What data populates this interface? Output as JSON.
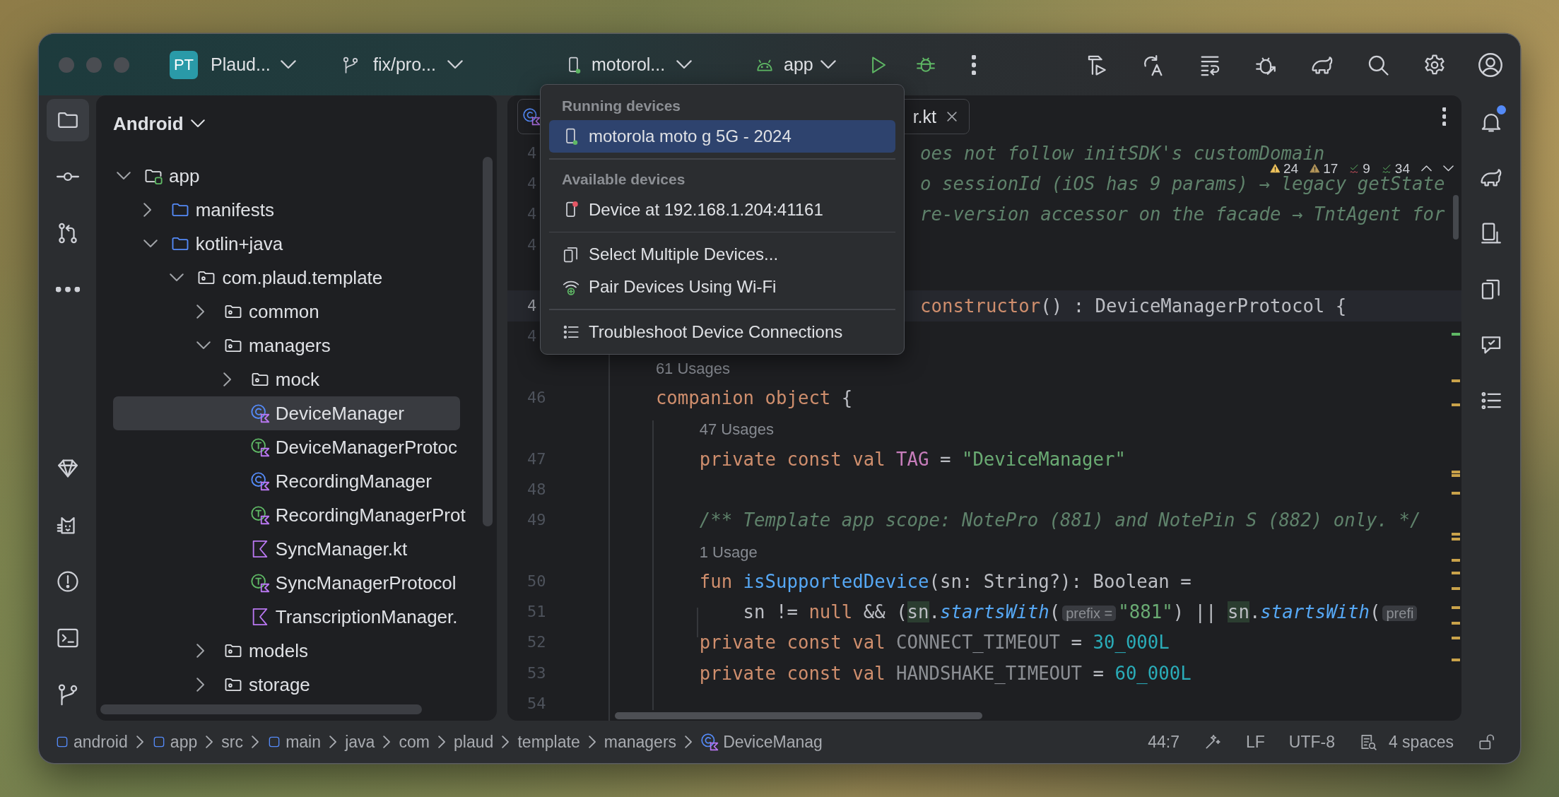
{
  "title_bar": {
    "project_badge": "PT",
    "project": "Plaud...",
    "branch": "fix/pro...",
    "device": "motorol...",
    "device_running": true,
    "run_config": "app"
  },
  "left_toolbar": {
    "top": [
      {
        "kind": "project",
        "selected": true
      },
      {
        "kind": "commit",
        "selected": false
      },
      {
        "kind": "pull_requests",
        "selected": false
      },
      {
        "kind": "more",
        "selected": false
      }
    ],
    "bottom": [
      {
        "kind": "gem",
        "selected": false
      },
      {
        "kind": "cat",
        "selected": false
      },
      {
        "kind": "problems",
        "selected": false
      },
      {
        "kind": "terminal",
        "selected": false
      },
      {
        "kind": "version_control",
        "selected": false
      }
    ]
  },
  "project_panel": {
    "view": "Android",
    "tree": [
      {
        "label": "app",
        "kind": "module",
        "expanded": true,
        "selected": false,
        "children": [
          {
            "label": "manifests",
            "kind": "folder",
            "expanded": false,
            "selected": false
          },
          {
            "label": "kotlin+java",
            "kind": "folder",
            "expanded": true,
            "selected": false,
            "children": [
              {
                "label": "com.plaud.template",
                "kind": "package",
                "expanded": true,
                "selected": false,
                "children": [
                  {
                    "label": "common",
                    "kind": "package",
                    "expanded": false,
                    "selected": false
                  },
                  {
                    "label": "managers",
                    "kind": "package",
                    "expanded": true,
                    "selected": false,
                    "children": [
                      {
                        "label": "mock",
                        "kind": "package",
                        "expanded": false,
                        "selected": false
                      },
                      {
                        "label": "DeviceManager",
                        "kind": "class",
                        "selected": true
                      },
                      {
                        "label": "DeviceManagerProtoc",
                        "kind": "interface",
                        "selected": false
                      },
                      {
                        "label": "RecordingManager",
                        "kind": "class",
                        "selected": false
                      },
                      {
                        "label": "RecordingManagerProt",
                        "kind": "interface",
                        "selected": false
                      },
                      {
                        "label": "SyncManager.kt",
                        "kind": "kotlin_file",
                        "selected": false
                      },
                      {
                        "label": "SyncManagerProtocol",
                        "kind": "interface",
                        "selected": false
                      },
                      {
                        "label": "TranscriptionManager.",
                        "kind": "kotlin_file",
                        "selected": false
                      }
                    ]
                  },
                  {
                    "label": "models",
                    "kind": "package",
                    "expanded": false,
                    "selected": false
                  },
                  {
                    "label": "storage",
                    "kind": "package",
                    "expanded": false,
                    "selected": false
                  }
                ]
              }
            ]
          }
        ]
      }
    ]
  },
  "editor": {
    "tab": {
      "label": "r.kt",
      "selected": true
    },
    "inspections": [
      {
        "kind": "warning",
        "count": "24"
      },
      {
        "kind": "weak_warning",
        "count": "17"
      },
      {
        "kind": "typo",
        "count": "9"
      },
      {
        "kind": "grammar",
        "count": "34"
      }
    ],
    "rows": [
      {
        "kind": "clipped",
        "number": "4",
        "current": false,
        "segments": [
          {
            "kind": "doc",
            "text": "oes not follow initSDK's customDomain"
          }
        ]
      },
      {
        "kind": "clipped",
        "number": "4",
        "current": false,
        "segments": [
          {
            "kind": "doc",
            "text": "o sessionId (iOS has 9 params) → legacy getState"
          }
        ]
      },
      {
        "kind": "clipped",
        "number": "4",
        "current": false,
        "segments": [
          {
            "kind": "doc",
            "text": "re-version accessor on the facade → TntAgent for"
          }
        ]
      },
      {
        "kind": "code",
        "number": "4",
        "current": false
      },
      {
        "kind": "blank",
        "current": false
      },
      {
        "kind": "clipped",
        "number": "4",
        "current": true,
        "segments": [
          {
            "kind": "kw",
            "text": "constructor"
          },
          {
            "kind": "plain",
            "text": "() : DeviceManagerProtocol {"
          }
        ]
      },
      {
        "kind": "code",
        "number": "4",
        "current": false
      },
      {
        "kind": "usage",
        "current": false,
        "segments": [
          {
            "kind": "hint",
            "text": "    61 Usages"
          }
        ]
      },
      {
        "kind": "code",
        "number": "46",
        "current": false,
        "segments": [
          {
            "kind": "kw",
            "text": "    companion object"
          },
          {
            "kind": "plain",
            "text": " {"
          }
        ]
      },
      {
        "kind": "usage",
        "current": false,
        "segments": [
          {
            "kind": "hint",
            "text": "        47 Usages"
          }
        ]
      },
      {
        "kind": "code",
        "number": "47",
        "current": false,
        "segments": [
          {
            "kind": "kw",
            "text": "        private const val "
          },
          {
            "kind": "const",
            "text": "TAG"
          },
          {
            "kind": "plain",
            "text": " = "
          },
          {
            "kind": "str",
            "text": "\"DeviceManager\""
          }
        ]
      },
      {
        "kind": "code",
        "number": "48",
        "current": false
      },
      {
        "kind": "code",
        "number": "49",
        "current": false,
        "segments": [
          {
            "kind": "doc",
            "text": "        /** Template app scope: NotePro (881) and NotePin S (882) only. */"
          }
        ]
      },
      {
        "kind": "usage",
        "current": false,
        "segments": [
          {
            "kind": "hint",
            "text": "        1 Usage"
          }
        ]
      },
      {
        "kind": "code",
        "number": "50",
        "current": false,
        "segments": [
          {
            "kind": "kw",
            "text": "        fun "
          },
          {
            "kind": "fn",
            "text": "isSupportedDevice"
          },
          {
            "kind": "plain",
            "text": "(sn: String?): Boolean ="
          }
        ]
      },
      {
        "kind": "code",
        "number": "51",
        "current": false,
        "segments": [
          {
            "kind": "plain",
            "text": "            sn != "
          },
          {
            "kind": "kw",
            "text": "null"
          },
          {
            "kind": "plain",
            "text": " && ("
          },
          {
            "kind": "ref",
            "text": "sn"
          },
          {
            "kind": "plain",
            "text": "."
          },
          {
            "kind": "call",
            "text": "startsWith"
          },
          {
            "kind": "plain",
            "text": "("
          },
          {
            "kind": "inlay",
            "text": "prefix ="
          },
          {
            "kind": "str",
            "text": "\"881\""
          },
          {
            "kind": "plain",
            "text": ") || "
          },
          {
            "kind": "ref",
            "text": "sn"
          },
          {
            "kind": "plain",
            "text": "."
          },
          {
            "kind": "call",
            "text": "startsWith"
          },
          {
            "kind": "plain",
            "text": "("
          },
          {
            "kind": "inlay",
            "text": "prefi"
          }
        ]
      },
      {
        "kind": "code",
        "number": "52",
        "current": false,
        "segments": [
          {
            "kind": "kw",
            "text": "        private const val "
          },
          {
            "kind": "dim",
            "text": "CONNECT_TIMEOUT"
          },
          {
            "kind": "plain",
            "text": " = "
          },
          {
            "kind": "num",
            "text": "30_000L"
          }
        ]
      },
      {
        "kind": "code",
        "number": "53",
        "current": false,
        "segments": [
          {
            "kind": "kw",
            "text": "        private const val "
          },
          {
            "kind": "dim",
            "text": "HANDSHAKE_TIMEOUT"
          },
          {
            "kind": "plain",
            "text": " = "
          },
          {
            "kind": "num",
            "text": "60_000L"
          }
        ]
      },
      {
        "kind": "code",
        "number": "54",
        "current": false
      }
    ]
  },
  "right_toolbar": [
    {
      "kind": "notifications",
      "selected": false,
      "unread": true
    },
    {
      "kind": "gradle",
      "selected": false
    },
    {
      "kind": "device_manager",
      "selected": false
    },
    {
      "kind": "running_devices",
      "selected": false
    },
    {
      "kind": "assistant",
      "selected": false
    },
    {
      "kind": "structure",
      "selected": false
    }
  ],
  "device_menu": {
    "sections": [
      {
        "header": "Running devices",
        "items": [
          {
            "label": "motorola moto g 5G - 2024",
            "kind": "running_device",
            "selected": true
          }
        ]
      },
      {
        "header": "Available devices",
        "items": [
          {
            "label": "Device at 192.168.1.204:41161",
            "kind": "offline_device",
            "selected": false
          }
        ]
      },
      {
        "items": [
          {
            "label": "Select Multiple Devices...",
            "kind": "multi_select",
            "selected": false
          },
          {
            "label": "Pair Devices Using Wi-Fi",
            "kind": "wifi_pair",
            "selected": false
          }
        ]
      },
      {
        "items": [
          {
            "label": "Troubleshoot Device Connections",
            "kind": "troubleshoot",
            "selected": false
          }
        ]
      }
    ]
  },
  "status_bar": {
    "breadcrumbs": [
      {
        "label": "android",
        "kind": "module"
      },
      {
        "label": "app",
        "kind": "module"
      },
      {
        "label": "src",
        "kind": "folder"
      },
      {
        "label": "main",
        "kind": "module"
      },
      {
        "label": "java",
        "kind": "folder"
      },
      {
        "label": "com",
        "kind": "folder"
      },
      {
        "label": "plaud",
        "kind": "folder"
      },
      {
        "label": "template",
        "kind": "folder"
      },
      {
        "label": "managers",
        "kind": "folder"
      },
      {
        "label": "DeviceManag",
        "kind": "class"
      }
    ],
    "position": "44:7",
    "line_separator": "LF",
    "encoding": "UTF-8",
    "indent": "4 spaces",
    "read_only": false
  }
}
